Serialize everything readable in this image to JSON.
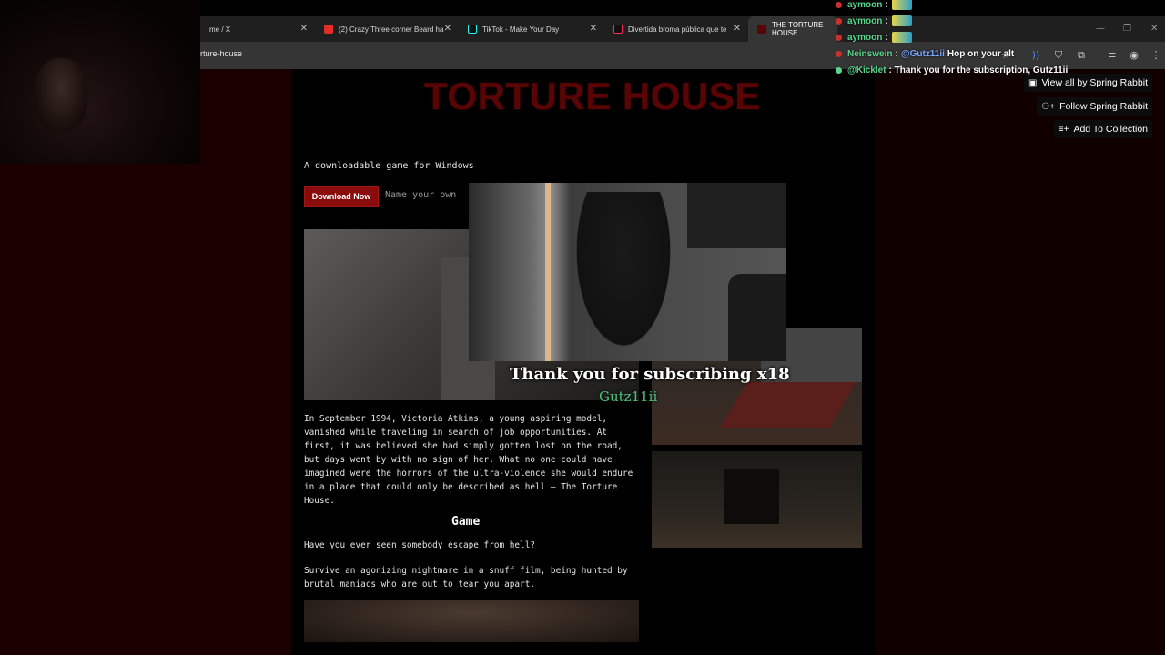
{
  "browser": {
    "tabs": [
      {
        "label": "me / X",
        "icon": "x-icon"
      },
      {
        "label": "(2) Crazy Three corner Beard ha",
        "icon": "youtube-icon"
      },
      {
        "label": "TikTok - Make Your Day",
        "icon": "tiktok-icon"
      },
      {
        "label": "Divertida broma pública que te",
        "icon": "tiktok-icon"
      },
      {
        "label": "THE TORTURE HOUSE",
        "icon": "itch-icon"
      }
    ],
    "url": "rture-house"
  },
  "page": {
    "title": "TORTURE HOUSE",
    "tagline": "A downloadable game for Windows",
    "download_label": "Download Now",
    "price_label": "Name your own",
    "description": "In September 1994, Victoria Atkins, a young aspiring model, vanished while traveling in search of job opportunities. At first, it was believed she had simply gotten lost on the road, but days went by with no sign of her. What no one could have imagined were the horrors of the ultra-violence she would endure in a place that could only be described as hell — The Torture House.",
    "section_heading": "Game",
    "paragraph_1": "Have you ever seen somebody escape from hell?",
    "paragraph_2": "Survive an agonizing nightmare in a snuff film, being hunted by brutal maniacs who are out to tear you apart."
  },
  "itch_actions": {
    "view_all": "View all by Spring Rabbit",
    "follow": "Follow Spring Rabbit",
    "add_collection": "Add To Collection"
  },
  "alert": {
    "title": "Thank you for subscribing x18",
    "user": "Gutz11ii"
  },
  "chat": [
    {
      "user": "aymoon",
      "text": ""
    },
    {
      "user": "aymoon",
      "text": ""
    },
    {
      "user": "aymoon",
      "text": ""
    },
    {
      "user": "Neinswein",
      "mention": "@Gutz11ii",
      "text": "Hop on your alt"
    },
    {
      "user": "@Kicklet",
      "text": "Thank you for the subscription, Gutz11ii"
    }
  ],
  "colors": {
    "title_red": "#5a0505",
    "button_red": "#8a0b0b",
    "alert_green": "#4ec27a",
    "chat_name_green": "#59d68c",
    "background_maroon": "#1a0000"
  }
}
